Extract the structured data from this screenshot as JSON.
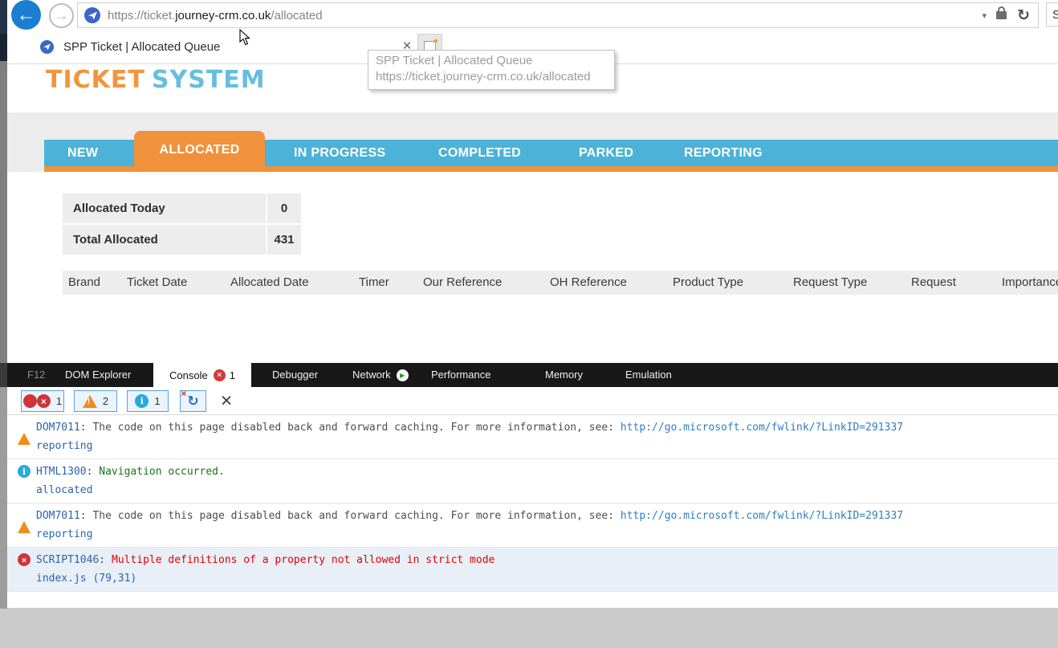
{
  "browser": {
    "url": {
      "prefix": "https://ticket.",
      "domain": "journey-crm.co.uk",
      "path": "/allocated"
    },
    "search_text": "Se",
    "tab": {
      "title": "SPP Ticket | Allocated Queue"
    },
    "tooltip": {
      "title": "SPP Ticket | Allocated Queue",
      "url": "https://ticket.journey-crm.co.uk/allocated"
    }
  },
  "app": {
    "logo": {
      "part1": "TICKET",
      "part2": "SYSTEM"
    },
    "nav": [
      {
        "label": "NEW",
        "active": false
      },
      {
        "label": "ALLOCATED",
        "active": true
      },
      {
        "label": "IN PROGRESS",
        "active": false
      },
      {
        "label": "COMPLETED",
        "active": false
      },
      {
        "label": "PARKED",
        "active": false
      },
      {
        "label": "REPORTING",
        "active": false
      }
    ],
    "stats": [
      {
        "label": "Allocated Today",
        "value": "0"
      },
      {
        "label": "Total Allocated",
        "value": "431"
      }
    ],
    "columns": [
      "Brand",
      "Ticket Date",
      "Allocated Date",
      "Timer",
      "Our Reference",
      "OH Reference",
      "Product Type",
      "Request Type",
      "Request",
      "Importance"
    ]
  },
  "devtools": {
    "tabs": {
      "f12": "F12",
      "dom": "DOM Explorer",
      "console": "Console",
      "debugger": "Debugger",
      "network": "Network",
      "performance": "Performance",
      "memory": "Memory",
      "emulation": "Emulation"
    },
    "console_badge": "1",
    "counts": {
      "errors": "1",
      "warnings": "2",
      "info": "1"
    },
    "separator": ": ",
    "messages": [
      {
        "type": "warning",
        "code": "DOM7011",
        "text": "The code on this page disabled back and forward caching. For more information, see: ",
        "link": "http://go.microsoft.com/fwlink/?LinkID=291337",
        "source": "reporting"
      },
      {
        "type": "info",
        "code": "HTML1300",
        "text": "Navigation occurred.",
        "source": "allocated"
      },
      {
        "type": "warning",
        "code": "DOM7011",
        "text": "The code on this page disabled back and forward caching. For more information, see: ",
        "link": "http://go.microsoft.com/fwlink/?LinkID=291337",
        "source": "reporting"
      },
      {
        "type": "error",
        "code": "SCRIPT1046",
        "text": "Multiple definitions of a property not allowed in strict mode",
        "source": "index.js (79,31)"
      }
    ]
  },
  "icons": {
    "back": "←",
    "forward": "→",
    "dropdown": "▾",
    "refresh": "↻",
    "close": "×",
    "newtab_star": "*",
    "error_x": "×",
    "warning_mark": "!",
    "info_mark": "i",
    "clear": "×",
    "clear_nav_arrow": "↻",
    "clear_nav_x": "×",
    "play": "▶"
  },
  "colors": {
    "accent_orange": "#F0913C",
    "accent_blue": "#4CB2D7",
    "logo_orange": "#F2953C",
    "logo_blue": "#66BEDE",
    "error_red": "#D13438",
    "warning_orange": "#F08C1E",
    "info_blue": "#29A8DD",
    "code_blue": "#2A64AD",
    "link_blue": "#2B7EC5",
    "message_green": "#157615",
    "message_red": "#E60000",
    "back_button_blue": "#1B7ED0"
  }
}
